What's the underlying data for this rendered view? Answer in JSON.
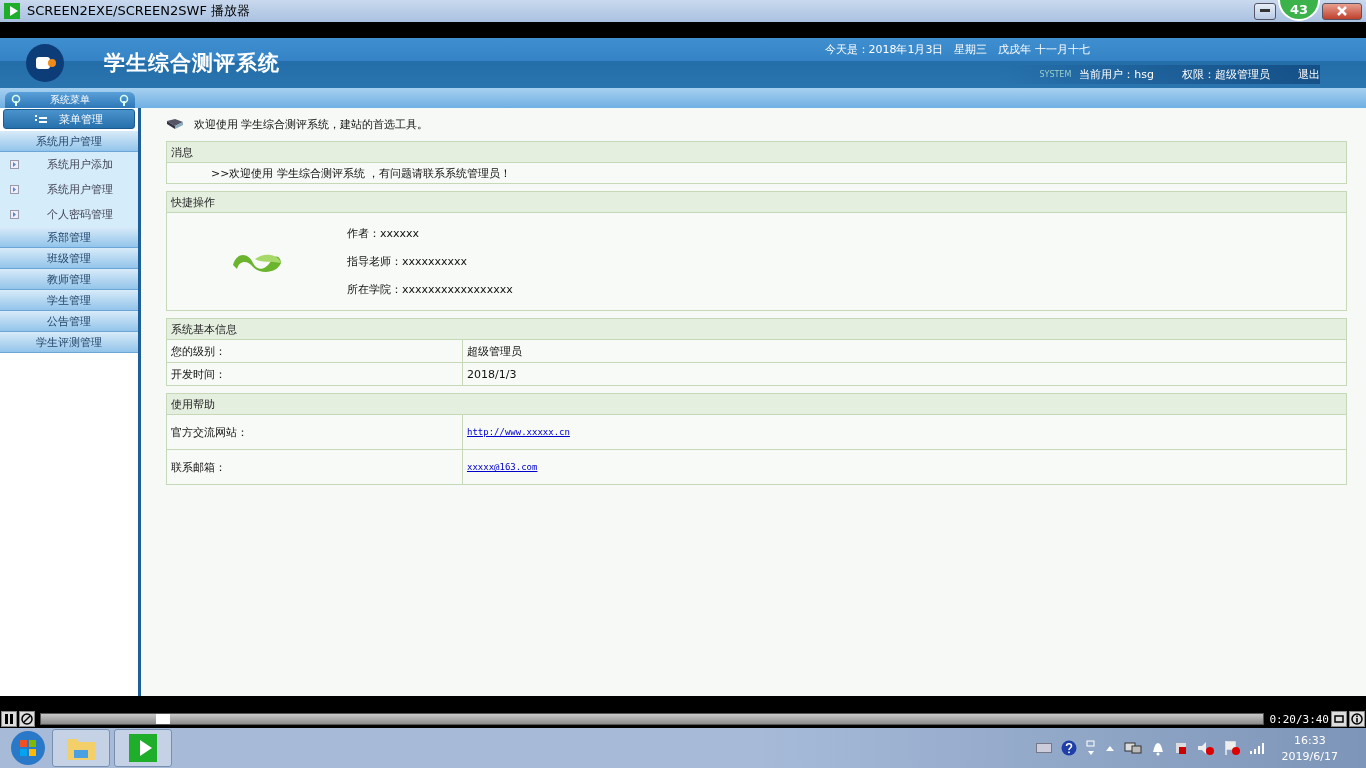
{
  "window": {
    "title": "SCREEN2EXE/SCREEN2SWF 播放器",
    "badge": "43"
  },
  "header": {
    "title": "学生综合测评系统",
    "date": "今天是：2018年1月3日　星期三　戊戌年 十一月十七",
    "system_label": "SYSTEM",
    "current_user": "当前用户：hsg",
    "permission": "权限：超级管理员",
    "logout": "退出"
  },
  "sidebar": {
    "title": "系统菜单",
    "menu_button": "菜单管理",
    "items": [
      {
        "label": "系统用户管理",
        "children": [
          {
            "label": "系统用户添加"
          },
          {
            "label": "系统用户管理"
          },
          {
            "label": "个人密码管理"
          }
        ]
      },
      {
        "label": "系部管理"
      },
      {
        "label": "班级管理"
      },
      {
        "label": "教师管理"
      },
      {
        "label": "学生管理"
      },
      {
        "label": "公告管理"
      },
      {
        "label": "学生评测管理"
      }
    ]
  },
  "welcome": "欢迎使用 学生综合测评系统，建站的首选工具。",
  "sections": [
    {
      "kind": "message",
      "title": "消息",
      "text": ">>欢迎使用 学生综合测评系统 ，有问题请联系系统管理员！"
    },
    {
      "kind": "quick",
      "title": "快捷操作",
      "lines": [
        "作者：xxxxxx",
        "指导老师：xxxxxxxxxx",
        "所在学院：xxxxxxxxxxxxxxxxx"
      ]
    },
    {
      "kind": "table",
      "title": "系统基本信息",
      "rows": [
        {
          "label": "您的级别：",
          "value": "超级管理员",
          "link": false
        },
        {
          "label": "开发时间：",
          "value": "2018/1/3",
          "link": false
        }
      ]
    },
    {
      "kind": "table",
      "title": "使用帮助",
      "rows": [
        {
          "label": "官方交流网站：",
          "value": "http://www.xxxxx.cn",
          "link": true
        },
        {
          "label": "联系邮箱：",
          "value": "xxxxx@163.com",
          "link": true
        }
      ]
    }
  ],
  "player": {
    "level": 0.1,
    "time": "0:20/3:40"
  },
  "taskbar": {
    "time": "16:33",
    "date": "2019/6/17"
  }
}
